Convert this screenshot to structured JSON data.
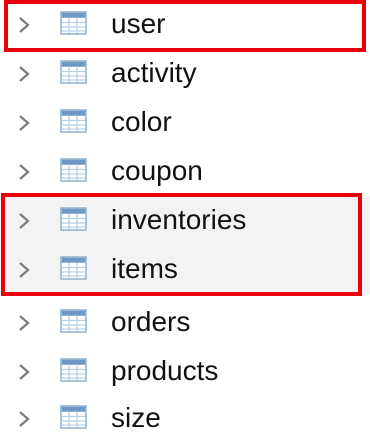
{
  "tree": {
    "items": [
      {
        "label": "user",
        "icon": "table-icon",
        "shaded": false
      },
      {
        "label": "activity",
        "icon": "table-icon",
        "shaded": false
      },
      {
        "label": "color",
        "icon": "table-icon",
        "shaded": false
      },
      {
        "label": "coupon",
        "icon": "table-icon",
        "shaded": false
      },
      {
        "label": "inventories",
        "icon": "table-icon",
        "shaded": true
      },
      {
        "label": "items",
        "icon": "table-icon",
        "shaded": true
      },
      {
        "label": "orders",
        "icon": "table-icon",
        "shaded": false
      },
      {
        "label": "products",
        "icon": "table-icon",
        "shaded": false
      },
      {
        "label": "size",
        "icon": "table-icon",
        "shaded": false
      }
    ],
    "expand_icon": "chevron-right-icon"
  },
  "colors": {
    "highlight": "#e8000b",
    "icon_border": "#8fb0cd",
    "icon_header": "#6e99c4",
    "icon_grid": "#b8d0e6",
    "chevron": "#7a7a7a",
    "shaded_row": "#f3f3f3"
  }
}
